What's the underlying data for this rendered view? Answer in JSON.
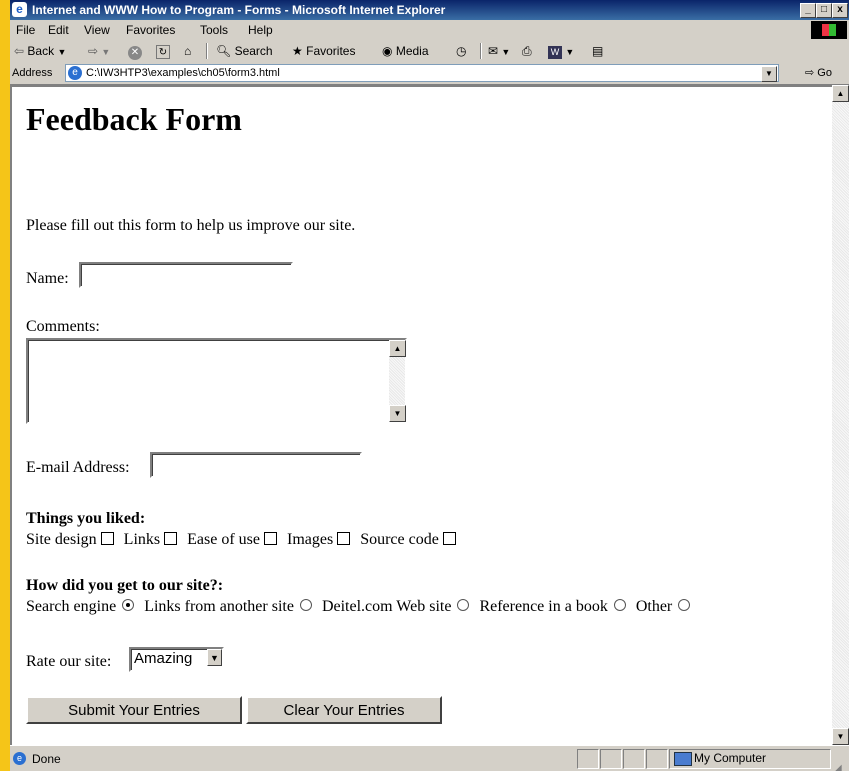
{
  "window": {
    "title": "Internet and WWW How to Program - Forms - Microsoft Internet Explorer",
    "controls": [
      "_",
      "□",
      "x"
    ]
  },
  "menu": [
    "File",
    "Edit",
    "View",
    "Favorites",
    "Tools",
    "Help"
  ],
  "toolbar": {
    "back": "Back",
    "search": "Search",
    "favorites": "Favorites",
    "media": "Media"
  },
  "address": {
    "label": "Address",
    "url": "C:\\IW3HTP3\\examples\\ch05\\form3.html",
    "go": "Go"
  },
  "page": {
    "title": "Feedback Form",
    "intro": "Please fill out this form to help us improve our site.",
    "name_label": "Name:",
    "name_value": "",
    "comments_label": "Comments:",
    "comments_value": "",
    "email_label": "E-mail Address:",
    "email_value": "",
    "liked_heading": "Things you liked:",
    "liked_options": [
      {
        "label": "Site design",
        "checked": false
      },
      {
        "label": "Links",
        "checked": false
      },
      {
        "label": "Ease of use",
        "checked": false
      },
      {
        "label": "Images",
        "checked": false
      },
      {
        "label": "Source code",
        "checked": false
      }
    ],
    "how_heading": "How did you get to our site?:",
    "how_options": [
      {
        "label": "Search engine",
        "selected": true
      },
      {
        "label": "Links from another site",
        "selected": false
      },
      {
        "label": "Deitel.com Web site",
        "selected": false
      },
      {
        "label": "Reference in a book",
        "selected": false
      },
      {
        "label": "Other",
        "selected": false
      }
    ],
    "rate_label": "Rate our site:",
    "rate_value": "Amazing",
    "submit_label": "Submit Your Entries",
    "clear_label": "Clear Your Entries"
  },
  "status": {
    "text": "Done",
    "zone": "My Computer"
  }
}
